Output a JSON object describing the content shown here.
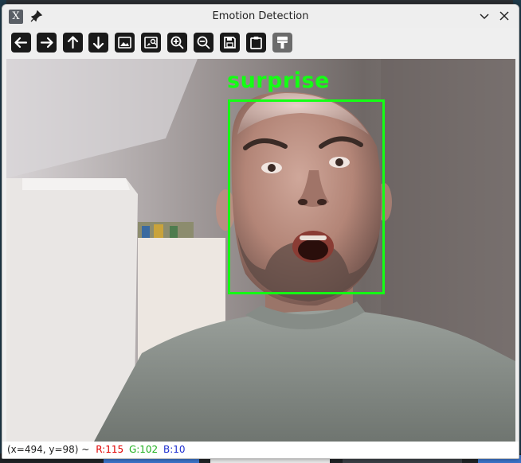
{
  "window": {
    "title": "Emotion Detection",
    "app_icon_glyph": "X"
  },
  "toolbar": {
    "tools": [
      {
        "name": "pan-left",
        "icon": "arrow-left-icon"
      },
      {
        "name": "pan-right",
        "icon": "arrow-right-icon"
      },
      {
        "name": "pan-up",
        "icon": "arrow-up-icon"
      },
      {
        "name": "pan-down",
        "icon": "arrow-down-icon"
      },
      {
        "name": "zoom-image",
        "icon": "image-icon"
      },
      {
        "name": "zoom-original",
        "icon": "image-search-icon"
      },
      {
        "name": "zoom-in",
        "icon": "zoom-in-icon"
      },
      {
        "name": "zoom-out",
        "icon": "zoom-out-icon"
      },
      {
        "name": "save",
        "icon": "save-icon"
      },
      {
        "name": "copy-clipboard",
        "icon": "clipboard-icon"
      },
      {
        "name": "properties",
        "icon": "paint-brush-icon"
      }
    ]
  },
  "detection": {
    "label": "surprise",
    "color": "#14ff14"
  },
  "status": {
    "coords": "(x=494, y=98) ~",
    "r": "R:115",
    "g": "G:102",
    "b": "B:10"
  }
}
